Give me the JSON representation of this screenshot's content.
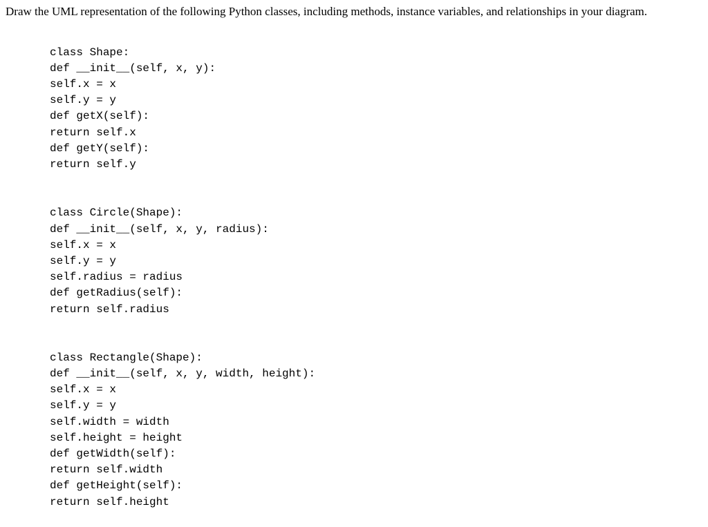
{
  "prompt": "Draw the UML representation of the following Python classes, including methods, instance variables, and relationships in your diagram.",
  "shape_class": {
    "line1": "class Shape:",
    "line2": "def __init__(self, x, y):",
    "line3": "self.x = x",
    "line4": "self.y = y",
    "line5": "def getX(self):",
    "line6": "return self.x",
    "line7": "def getY(self):",
    "line8": "return self.y"
  },
  "circle_class": {
    "line1": "class Circle(Shape):",
    "line2": "def __init__(self, x, y, radius):",
    "line3": "self.x = x",
    "line4": "self.y = y",
    "line5": "self.radius = radius",
    "line6": "def getRadius(self):",
    "line7": "return self.radius"
  },
  "rectangle_class": {
    "line1": "class Rectangle(Shape):",
    "line2": "def __init__(self, x, y, width, height):",
    "line3": "self.x = x",
    "line4": "self.y = y",
    "line5": "self.width = width",
    "line6": "self.height = height",
    "line7": "def getWidth(self):",
    "line8": "return self.width",
    "line9": "def getHeight(self):",
    "line10": "return self.height"
  }
}
